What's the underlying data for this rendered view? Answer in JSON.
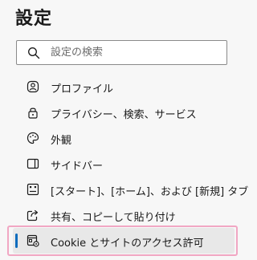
{
  "page": {
    "title": "設定"
  },
  "search": {
    "placeholder": "設定の検索",
    "icon": "search-icon"
  },
  "nav": {
    "items": [
      {
        "label": "プロファイル",
        "icon": "profile-icon"
      },
      {
        "label": "プライバシー、検索、サービス",
        "icon": "lock-icon"
      },
      {
        "label": "外観",
        "icon": "palette-icon"
      },
      {
        "label": "サイドバー",
        "icon": "sidebar-icon"
      },
      {
        "label": "[スタート]、[ホーム]、および [新規] タブ",
        "icon": "start-home-icon"
      },
      {
        "label": "共有、コピーして貼り付け",
        "icon": "share-icon"
      },
      {
        "label": "Cookie とサイトのアクセス許可",
        "icon": "cookie-permissions-icon",
        "selected": true
      }
    ]
  },
  "colors": {
    "accent": "#0f6cbd",
    "selected_bg": "#e8e8e8",
    "highlight_frame": "#f1a7c3"
  }
}
